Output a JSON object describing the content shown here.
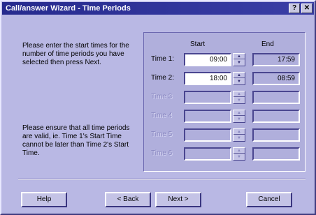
{
  "window": {
    "title": "Call/answer Wizard - Time Periods",
    "help_glyph": "?",
    "close_glyph": "✕"
  },
  "intro_text": "Please enter the start times for the number of time periods you have selected then press Next.",
  "note_text": "Please ensure that all time periods are valid, ie. Time 1's Start Time cannot be later than Time 2's Start Time.",
  "columns": {
    "start": "Start",
    "end": "End"
  },
  "rows": [
    {
      "label": "Time 1:",
      "start": "09:00",
      "end": "17:59",
      "enabled": true
    },
    {
      "label": "Time 2:",
      "start": "18:00",
      "end": "08:59",
      "enabled": true
    },
    {
      "label": "Time 3",
      "start": "",
      "end": "",
      "enabled": false
    },
    {
      "label": "Time 4",
      "start": "",
      "end": "",
      "enabled": false
    },
    {
      "label": "Time 5",
      "start": "",
      "end": "",
      "enabled": false
    },
    {
      "label": "Time 6",
      "start": "",
      "end": "",
      "enabled": false
    }
  ],
  "spin_glyphs": {
    "up": "▲",
    "down": "▼"
  },
  "buttons": {
    "help": "Help",
    "back": "< Back",
    "next": "Next >",
    "cancel": "Cancel"
  },
  "colors": {
    "titlebar": "#262a8e",
    "dialog_bg": "#b9b8e4"
  }
}
